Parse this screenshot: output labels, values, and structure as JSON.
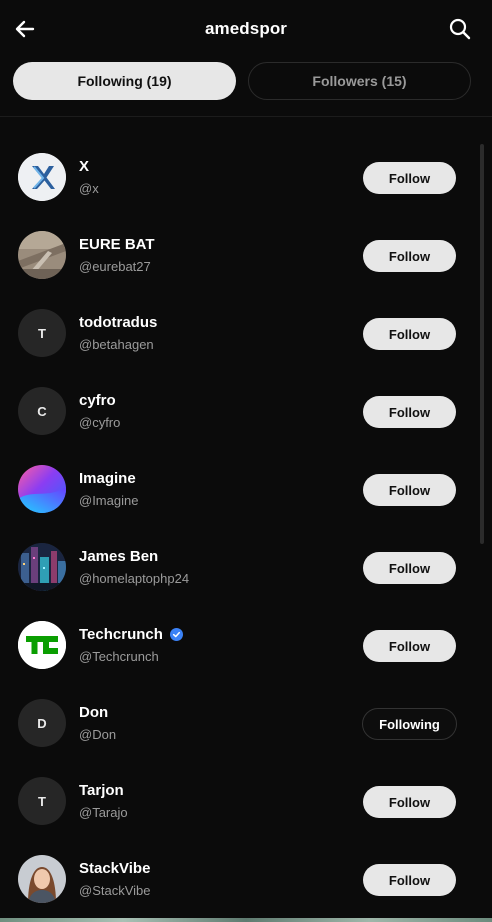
{
  "header": {
    "title": "amedspor",
    "back_icon": "arrow-left-icon",
    "search_icon": "search-icon"
  },
  "tabs": [
    {
      "label": "Following (19)",
      "active": true
    },
    {
      "label": "Followers (15)",
      "active": false
    }
  ],
  "users": [
    {
      "name": "X",
      "handle": "@x",
      "button": "Follow",
      "avatar": "x-logo-image",
      "initial": ""
    },
    {
      "name": "EURE BAT",
      "handle": "@eurebat27",
      "button": "Follow",
      "avatar": "photo-image",
      "initial": ""
    },
    {
      "name": "todotradus",
      "handle": "@betahagen",
      "button": "Follow",
      "avatar": "initial",
      "initial": "T"
    },
    {
      "name": "cyfro",
      "handle": "@cyfro",
      "button": "Follow",
      "avatar": "initial",
      "initial": "C"
    },
    {
      "name": "Imagine",
      "handle": "@Imagine",
      "button": "Follow",
      "avatar": "gradient-image",
      "initial": ""
    },
    {
      "name": "James Ben",
      "handle": "@homelaptophp24",
      "button": "Follow",
      "avatar": "city-image",
      "initial": ""
    },
    {
      "name": "Techcrunch",
      "handle": "@Techcrunch",
      "button": "Follow",
      "avatar": "techcrunch-logo",
      "initial": "",
      "verified": true
    },
    {
      "name": "Don",
      "handle": "@Don",
      "button": "Following",
      "avatar": "initial",
      "initial": "D"
    },
    {
      "name": "Tarjon",
      "handle": "@Tarajo",
      "button": "Follow",
      "avatar": "initial",
      "initial": "T"
    },
    {
      "name": "StackVibe",
      "handle": "@StackVibe",
      "button": "Follow",
      "avatar": "portrait-image",
      "initial": ""
    }
  ],
  "colors": {
    "background": "#0b0b0b",
    "button_bg": "#e7e7e7",
    "handle_text": "#9b9b9b",
    "verified_blue": "#3b82f6",
    "techcrunch_green": "#0a9e01"
  }
}
